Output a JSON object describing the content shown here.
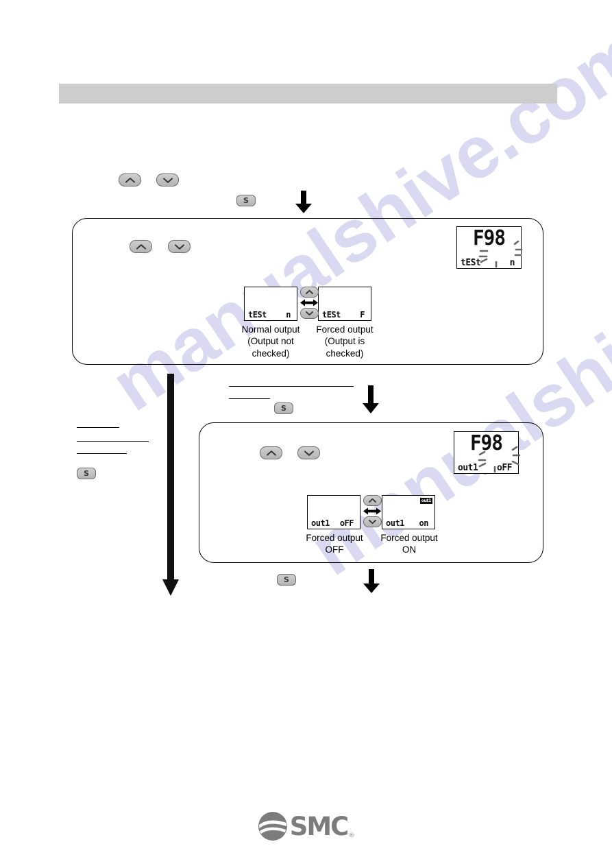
{
  "page": {
    "header_band_label": "",
    "watermark_text": "manualshive.com"
  },
  "keys": {
    "up_label": "",
    "down_label": "",
    "set_label": "S"
  },
  "icons": {
    "chevron_up": "chevron-up-icon",
    "chevron_down": "chevron-down-icon",
    "left_right_arrow": "left-right-arrow-icon",
    "down_arrow": "down-arrow-icon",
    "logo": "smc-logo-icon"
  },
  "step1": {
    "display": {
      "main": "F98",
      "sub_left": "tESt",
      "sub_right": "n",
      "blinking": true
    },
    "options": [
      {
        "display": {
          "main": "",
          "sub_left": "tESt",
          "sub_right": "n",
          "badge": ""
        },
        "caption": "Normal output\n(Output not\nchecked)"
      },
      {
        "display": {
          "main": "",
          "sub_left": "tESt",
          "sub_right": "F",
          "badge": ""
        },
        "caption": "Forced output\n(Output is\nchecked)"
      }
    ]
  },
  "step2": {
    "display": {
      "main": "F98",
      "sub_left": "out1",
      "sub_right": "oFF",
      "blinking": true
    },
    "options": [
      {
        "display": {
          "main": "",
          "sub_left": "out1",
          "sub_right": "oFF",
          "badge": ""
        },
        "caption": "Forced output\nOFF"
      },
      {
        "display": {
          "main": "",
          "sub_left": "out1",
          "sub_right": "on",
          "badge": "out1"
        },
        "caption": "Forced output\nON"
      }
    ]
  },
  "footer": {
    "brand": "SMC",
    "registered_mark": "®"
  }
}
